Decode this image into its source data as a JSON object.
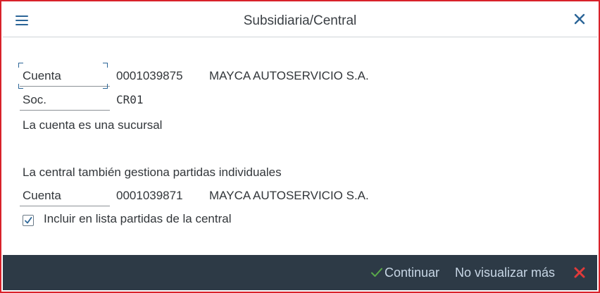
{
  "dialog": {
    "title": "Subsidiaria/Central",
    "menu_icon": "hamburger-menu-icon",
    "close_icon": "close-icon"
  },
  "account": {
    "label": "Cuenta",
    "number": "0001039875",
    "name": "MAYCA AUTOSERVICIO S.A."
  },
  "company": {
    "label": "Soc.",
    "code": "CR01"
  },
  "branch_note": "La cuenta es una sucursal",
  "central_note": "La central también gestiona partidas individuales",
  "central_account": {
    "label": "Cuenta",
    "number": "0001039871",
    "name": "MAYCA AUTOSERVICIO S.A."
  },
  "include_checkbox": {
    "label": "Incluir en lista partidas de la central",
    "checked": true
  },
  "footer": {
    "continue_label": "Continuar",
    "no_show_label": "No visualizar más",
    "cancel_icon": "red-x-icon"
  },
  "colors": {
    "frame_red": "#d8222a",
    "footer_bg": "#2d3a46",
    "footer_text": "#c8d7e6",
    "accent_blue": "#2b6597",
    "check_green": "#5aa94a",
    "cancel_red": "#e03a3a"
  }
}
